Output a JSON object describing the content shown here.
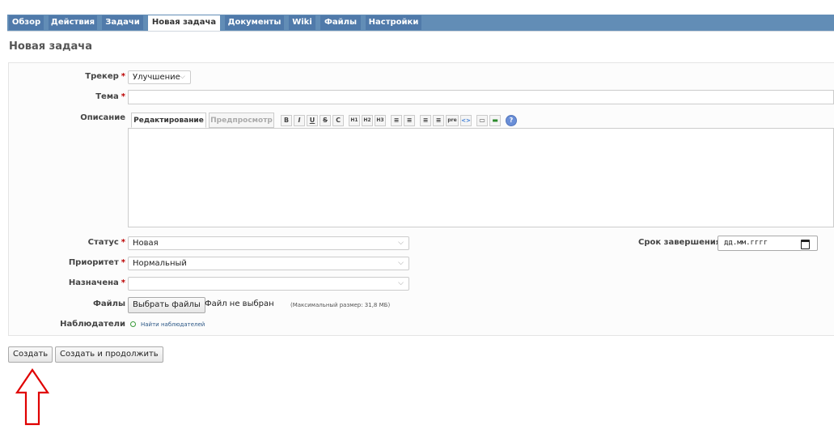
{
  "tabs": [
    "Обзор",
    "Действия",
    "Задачи",
    "Новая задача",
    "Документы",
    "Wiki",
    "Файлы",
    "Настройки"
  ],
  "page_title": "Новая задача",
  "form": {
    "tracker_label": "Трекер",
    "tracker_value": "Улучшение",
    "subject_label": "Тема",
    "description_label": "Описание",
    "editor_tab_edit": "Редактирование",
    "editor_tab_preview": "Предпросмотр",
    "toolbar": [
      "B",
      "I",
      "U",
      "S",
      "C",
      "H1",
      "H2",
      "H3",
      "≡",
      "≡",
      "≡",
      "≡",
      "pre",
      "<>",
      "▭",
      "▬",
      "?"
    ],
    "status_label": "Статус",
    "status_value": "Новая",
    "priority_label": "Приоритет",
    "priority_value": "Нормальный",
    "assignee_label": "Назначена",
    "assignee_value": "",
    "files_label": "Файлы",
    "choose_files": "Выбрать файлы",
    "no_file": "Файл не выбран",
    "max_size": "(Максимальный размер: 31,8 МБ)",
    "watchers_label": "Наблюдатели",
    "find_watchers": "Найти наблюдателей",
    "due_label": "Срок завершения",
    "due_placeholder": "дд.мм.гггг",
    "required_mark": "*"
  },
  "buttons": {
    "create": "Создать",
    "create_continue": "Создать и продолжить"
  },
  "colors": {
    "tab": "#507aaa",
    "tabbar": "#628db6",
    "arrow": "#e00000",
    "link": "#2a5685"
  },
  "annotation": {
    "icon": "up-arrow-outline"
  }
}
